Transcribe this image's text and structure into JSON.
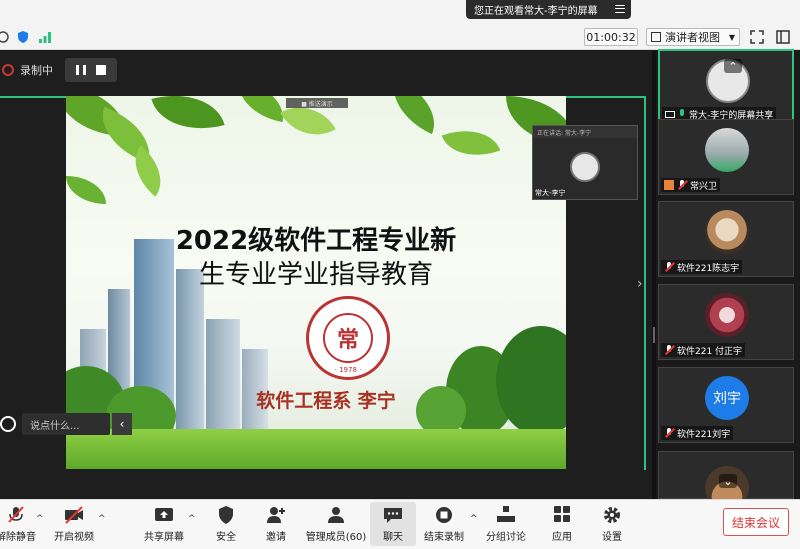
{
  "top": {
    "share_status": "您正在观看常大-李宁的屏幕",
    "timer": "01:00:32",
    "view_button": "演讲者视图"
  },
  "recording": {
    "label": "录制中"
  },
  "slide": {
    "title_line1": "2022级软件工程专业新",
    "title_line2": "生专业学业指导教育",
    "seal_char": "常",
    "seal_year": "· 1978 ·",
    "author": "软件工程系 李宁",
    "thumb_label": "■ 推送演示"
  },
  "presenter_thumb": {
    "bar_text": "正在讲话: 常大-李宁",
    "name": "常大-李宁"
  },
  "chat": {
    "placeholder": "说点什么..."
  },
  "participants": [
    {
      "name": "常大-李宁的屏幕共享",
      "mic": "on"
    },
    {
      "name": "常兴卫",
      "mic": "off"
    },
    {
      "name": "软件221陈志宇",
      "mic": "off"
    },
    {
      "name": "软件221 付正宇",
      "mic": "off"
    },
    {
      "name": "软件221刘宇",
      "mic": "off",
      "avatar_text": "刘宇"
    }
  ],
  "toolbar": {
    "mute": "解除静音",
    "video": "开启视频",
    "share": "共享屏幕",
    "security": "安全",
    "invite": "邀请",
    "members": "管理成员(60)",
    "chat": "聊天",
    "end_record": "结束录制",
    "breakout": "分组讨论",
    "apps": "应用",
    "settings": "设置",
    "end_meeting": "结束会议"
  },
  "colors": {
    "accent_green": "#2ec27e",
    "end_red": "#d33333",
    "slide_red": "#a83222",
    "avatar_blue": "#1d7ce8"
  }
}
